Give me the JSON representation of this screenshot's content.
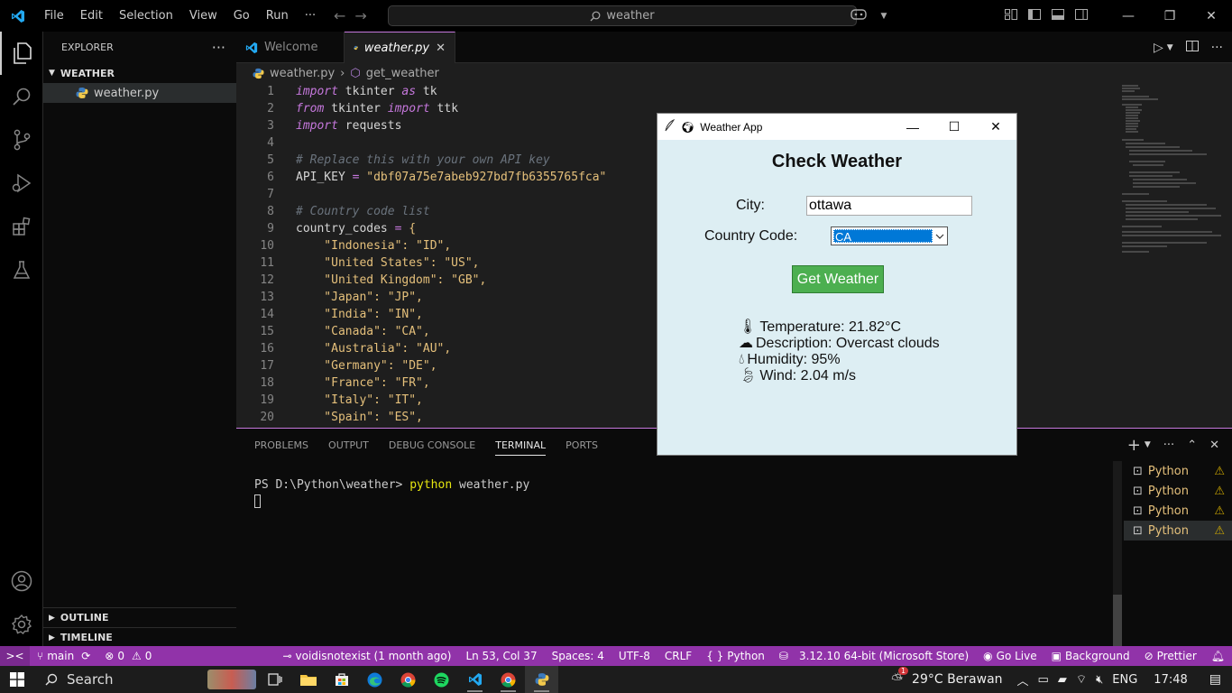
{
  "titlebar": {
    "menu": [
      "File",
      "Edit",
      "Selection",
      "View",
      "Go",
      "Run",
      "···"
    ],
    "search": "weather"
  },
  "sidebar": {
    "title": "EXPLORER",
    "folder": "WEATHER",
    "file": "weather.py",
    "outline": "OUTLINE",
    "timeline": "TIMELINE"
  },
  "tabs": [
    {
      "label": "Welcome"
    },
    {
      "label": "weather.py"
    }
  ],
  "breadcrumb": {
    "file": "weather.py",
    "symbol": "get_weather"
  },
  "editor": {
    "line_numbers": [
      "1",
      "2",
      "3",
      "4",
      "5",
      "6",
      "7",
      "8",
      "9",
      "10",
      "11",
      "12",
      "13",
      "14",
      "15",
      "16",
      "17",
      "18",
      "19",
      "20"
    ],
    "code": {
      "l1_kw": "import",
      "l1_mod": " tkinter ",
      "l1_as": "as",
      "l1_alias": " tk",
      "l2_kw": "from",
      "l2_mod": " tkinter ",
      "l2_imp": "import",
      "l2_name": " ttk",
      "l3_kw": "import",
      "l3_mod": " requests",
      "l5_cmt": "# Replace this with your own API key",
      "l6_name": "API_KEY",
      "l6_eq": " = ",
      "l6_val": "\"dbf07a75e7abeb927bd7fb6355765fca\"",
      "l8_cmt": "# Country code list",
      "l9_name": "country_codes",
      "l9_eq": " = ",
      "l9_brace": "{",
      "l10": "    \"Indonesia\": \"ID\",",
      "l11": "    \"United States\": \"US\",",
      "l12": "    \"United Kingdom\": \"GB\",",
      "l13": "    \"Japan\": \"JP\",",
      "l14": "    \"India\": \"IN\",",
      "l15": "    \"Canada\": \"CA\",",
      "l16": "    \"Australia\": \"AU\",",
      "l17": "    \"Germany\": \"DE\",",
      "l18": "    \"France\": \"FR\",",
      "l19": "    \"Italy\": \"IT\",",
      "l20": "    \"Spain\": \"ES\","
    }
  },
  "panel": {
    "tabs": [
      "PROBLEMS",
      "OUTPUT",
      "DEBUG CONSOLE",
      "TERMINAL",
      "PORTS"
    ],
    "prompt": "PS D:\\Python\\weather>",
    "command": "python",
    "args": " weather.py",
    "terminals": [
      "Python",
      "Python",
      "Python",
      "Python"
    ]
  },
  "statusbar": {
    "branch": "main",
    "problems": "0",
    "warnings": "0",
    "blame": "voidisnotexist (1 month ago)",
    "position": "Ln 53, Col 37",
    "spaces": "Spaces: 4",
    "encoding": "UTF-8",
    "eol": "CRLF",
    "language": "Python",
    "interpreter": "3.12.10 64-bit (Microsoft Store)",
    "golive": "Go Live",
    "background": "Background",
    "prettier": "Prettier"
  },
  "taskbar": {
    "search": "Search",
    "weather": "29°C Berawan",
    "lang": "ENG",
    "time": "17:48",
    "badge": "1"
  },
  "app": {
    "title": "Weather App",
    "heading": "Check Weather",
    "city_label": "City:",
    "city_value": "ottawa",
    "country_label": "Country Code:",
    "country_value": "CA",
    "button": "Get Weather",
    "temperature": "Temperature: 21.82°C",
    "description": "Description: Overcast clouds",
    "humidity": "Humidity: 95%",
    "wind": "Wind: 2.04 m/s"
  }
}
